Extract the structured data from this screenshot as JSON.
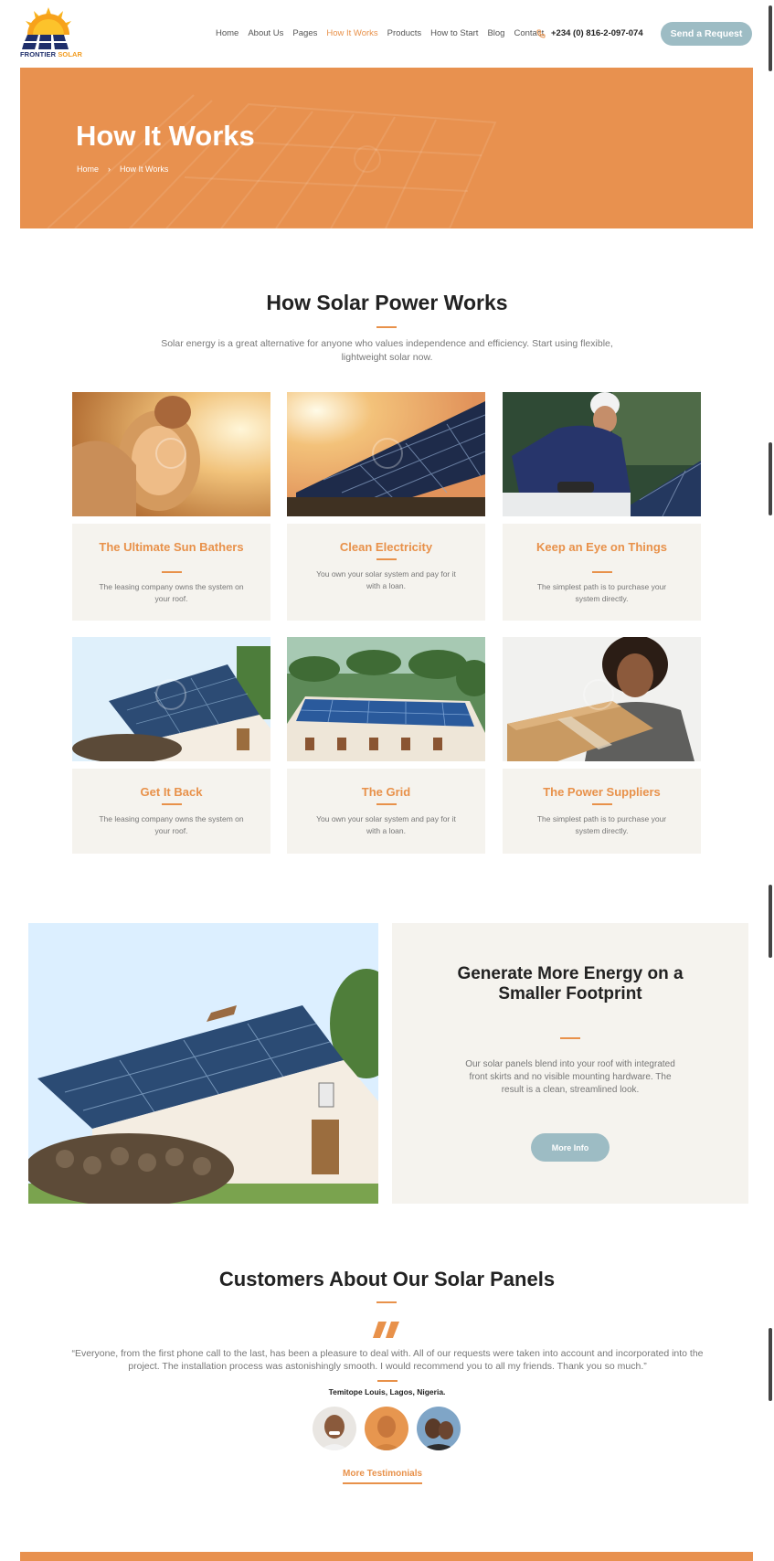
{
  "brand": {
    "name_part1": "FRONTIER",
    "name_part2": "SOLAR",
    "logo_color": "#1f2f6b",
    "sun_color": "#f9b21d"
  },
  "nav": {
    "items": [
      "Home",
      "About Us",
      "Pages",
      "How It Works",
      "Products",
      "How to Start",
      "Blog",
      "Contact"
    ],
    "active_index": 3
  },
  "phone": {
    "icon": "phone-icon",
    "number": "+234 (0) 816-2-097-074"
  },
  "header": {
    "cta_label": "Send a Request"
  },
  "hero": {
    "title": "How It Works",
    "breadcrumb": [
      "Home",
      "How It Works"
    ],
    "background": "#e8914f"
  },
  "how": {
    "title": "How Solar Power Works",
    "description": "Solar energy is a great alternative for anyone who values independence and efficiency. Start using flexible, lightweight solar now.",
    "cards": [
      {
        "title": "The Ultimate Sun Bathers",
        "text": "The leasing company owns the system on your roof."
      },
      {
        "title": "Clean Electricity",
        "text": "You own your solar system and pay for it with a loan."
      },
      {
        "title": "Keep an Eye on Things",
        "text": "The simplest path is to purchase your system directly."
      },
      {
        "title": "Get It Back",
        "text": "The leasing company owns the system on your roof."
      },
      {
        "title": "The Grid",
        "text": "You own your solar system and pay for it with a loan."
      },
      {
        "title": "The Power Suppliers",
        "text": "The simplest path is to purchase your system directly."
      }
    ]
  },
  "feature": {
    "title": "Generate More Energy on a Smaller Footprint",
    "text": "Our solar panels blend into your roof with integrated front skirts and no visible mounting hardware. The result is a clean, streamlined look.",
    "button_label": "More Info"
  },
  "testimonials": {
    "title": "Customers About Our Solar Panels",
    "quote": "“Everyone, from the first phone call to the last, has been a pleasure to deal with. All of our requests were taken into account and incorporated into the project. The installation process was astonishingly smooth. I would recommend you to all my friends. Thank you so much.”",
    "author": "Temitope Louis, Lagos, Nigeria.",
    "more_label": "More Testimonials"
  },
  "colors": {
    "accent": "#e8914a",
    "button": "#9dbcc4",
    "panel": "#f5f3ee"
  }
}
